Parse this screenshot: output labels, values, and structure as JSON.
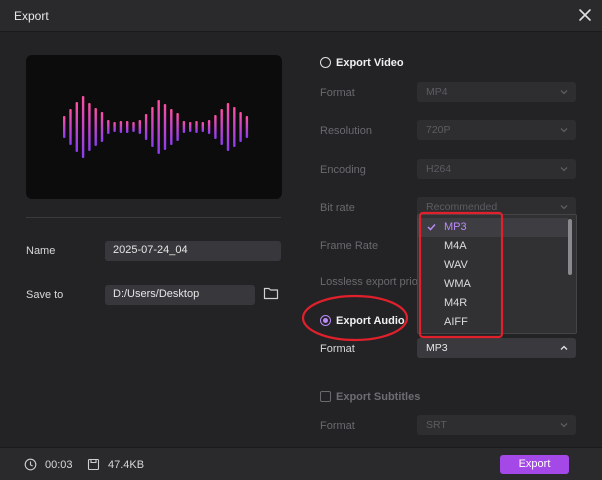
{
  "window": {
    "title": "Export"
  },
  "left": {
    "name_label": "Name",
    "name_value": "2025-07-24_04",
    "save_label": "Save to",
    "save_value": "D:/Users/Desktop"
  },
  "video": {
    "heading": "Export Video",
    "selected": false,
    "rows": [
      {
        "label": "Format",
        "value": "MP4"
      },
      {
        "label": "Resolution",
        "value": "720P"
      },
      {
        "label": "Encoding",
        "value": "H264"
      },
      {
        "label": "Bit rate",
        "value": "Recommended"
      },
      {
        "label": "Frame Rate",
        "value": ""
      },
      {
        "label": "Lossless export prio",
        "value": ""
      }
    ]
  },
  "audio": {
    "heading": "Export Audio",
    "selected": true,
    "format_label": "Format",
    "format_value": "MP3",
    "dropdown": {
      "options": [
        "MP3",
        "M4A",
        "WAV",
        "WMA",
        "M4R",
        "AIFF"
      ],
      "selected": "MP3"
    }
  },
  "subtitles": {
    "heading": "Export Subtitles",
    "checked": false,
    "format_label": "Format",
    "format_value": "SRT"
  },
  "footer": {
    "duration": "00:03",
    "size": "47.4KB",
    "export_label": "Export"
  },
  "icons": {
    "close": "close-icon",
    "folder": "folder-icon",
    "clock": "clock-icon",
    "file": "file-icon",
    "chevron": "chevron-down-icon",
    "check": "check-icon"
  },
  "colors": {
    "accent": "#a449e8",
    "accent_text": "#b98af7",
    "waveform_top": "#ff4fa0",
    "waveform_bottom": "#8a3cf0",
    "annotation": "#e0202a"
  }
}
